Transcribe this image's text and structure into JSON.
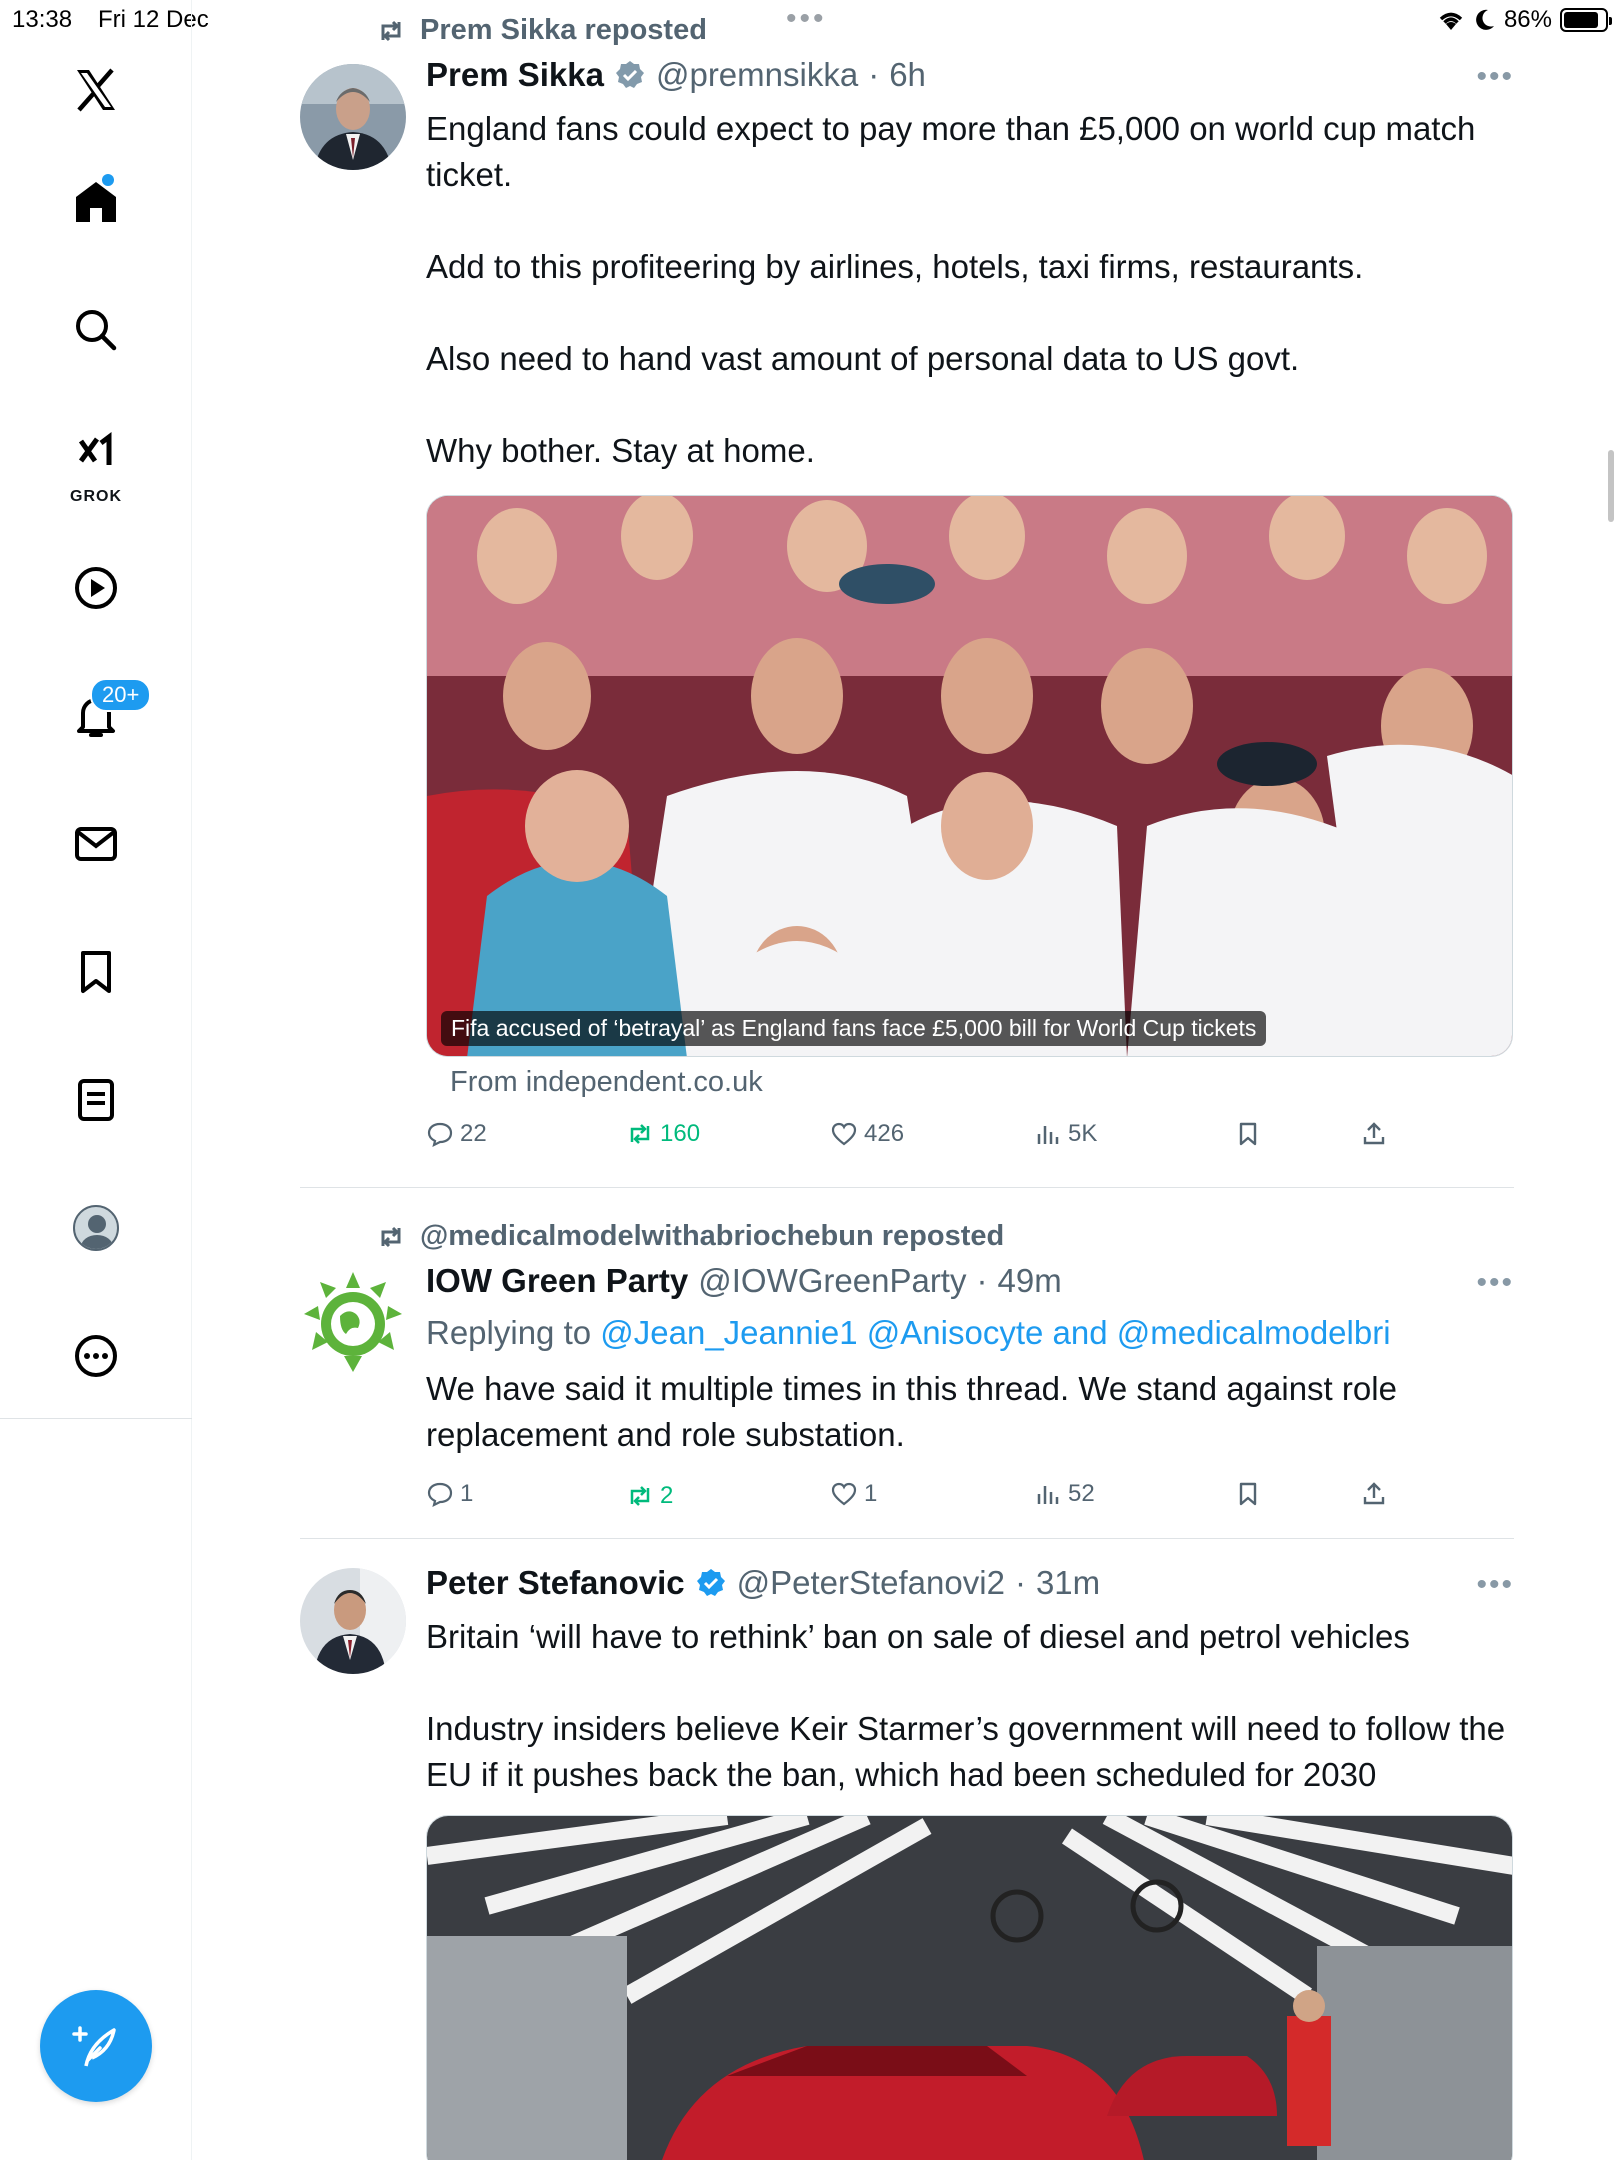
{
  "status_bar": {
    "time": "13:38",
    "date": "Fri 12 Dec",
    "battery": "86%",
    "battery_level": 0.86
  },
  "sidebar": {
    "notifications_badge": "20+",
    "grok_label": "GROK",
    "items": [
      "x-logo",
      "home",
      "search",
      "grok",
      "video",
      "notifications",
      "messages",
      "bookmarks",
      "lists",
      "profile",
      "more"
    ]
  },
  "posts": [
    {
      "repost_by": "Prem Sikka reposted",
      "name": "Prem Sikka",
      "verified": true,
      "handle": "@premnsikka",
      "time": "6h",
      "paragraphs": [
        "England fans could expect to pay more than £5,000 on world cup match ticket.",
        "Add to this profiteering by airlines, hotels, taxi firms, restaurants.",
        "Also need to hand vast amount of personal data to US govt.",
        "Why bother. Stay at home."
      ],
      "media_caption": "Fifa accused of ‘betrayal’ as England fans face £5,000 bill for World Cup tickets",
      "from": "From independent.co.uk",
      "stats": {
        "replies": "22",
        "reposts": "160",
        "likes": "426",
        "views": "5K"
      }
    },
    {
      "repost_by": "@medicalmodelwithabriochebun reposted",
      "name": "IOW Green Party",
      "verified": false,
      "handle": "@IOWGreenParty",
      "time": "49m",
      "replying_prefix": "Replying to ",
      "replying_mentions": "@Jean_Jeannie1 @Anisocyte and @medicalmodelbri",
      "paragraphs": [
        "We have said it multiple times in this thread. We stand against role replacement and role substation."
      ],
      "stats": {
        "replies": "1",
        "reposts": "2",
        "likes": "1",
        "views": "52"
      }
    },
    {
      "name": "Peter Stefanovic",
      "verified": true,
      "handle": "@PeterStefanovi2",
      "time": "31m",
      "paragraphs": [
        "Britain ‘will have to rethink’ ban on sale of diesel and petrol vehicles",
        "Industry insiders believe Keir Starmer’s government will need to follow the EU if it pushes back the ban, which had been scheduled for 2030"
      ]
    }
  ],
  "colors": {
    "accent": "#1d9bf0",
    "repost_green": "#00ba7c",
    "secondary_text": "#536471",
    "verified_gray": "#829aab",
    "green_party": "#5db33b"
  }
}
